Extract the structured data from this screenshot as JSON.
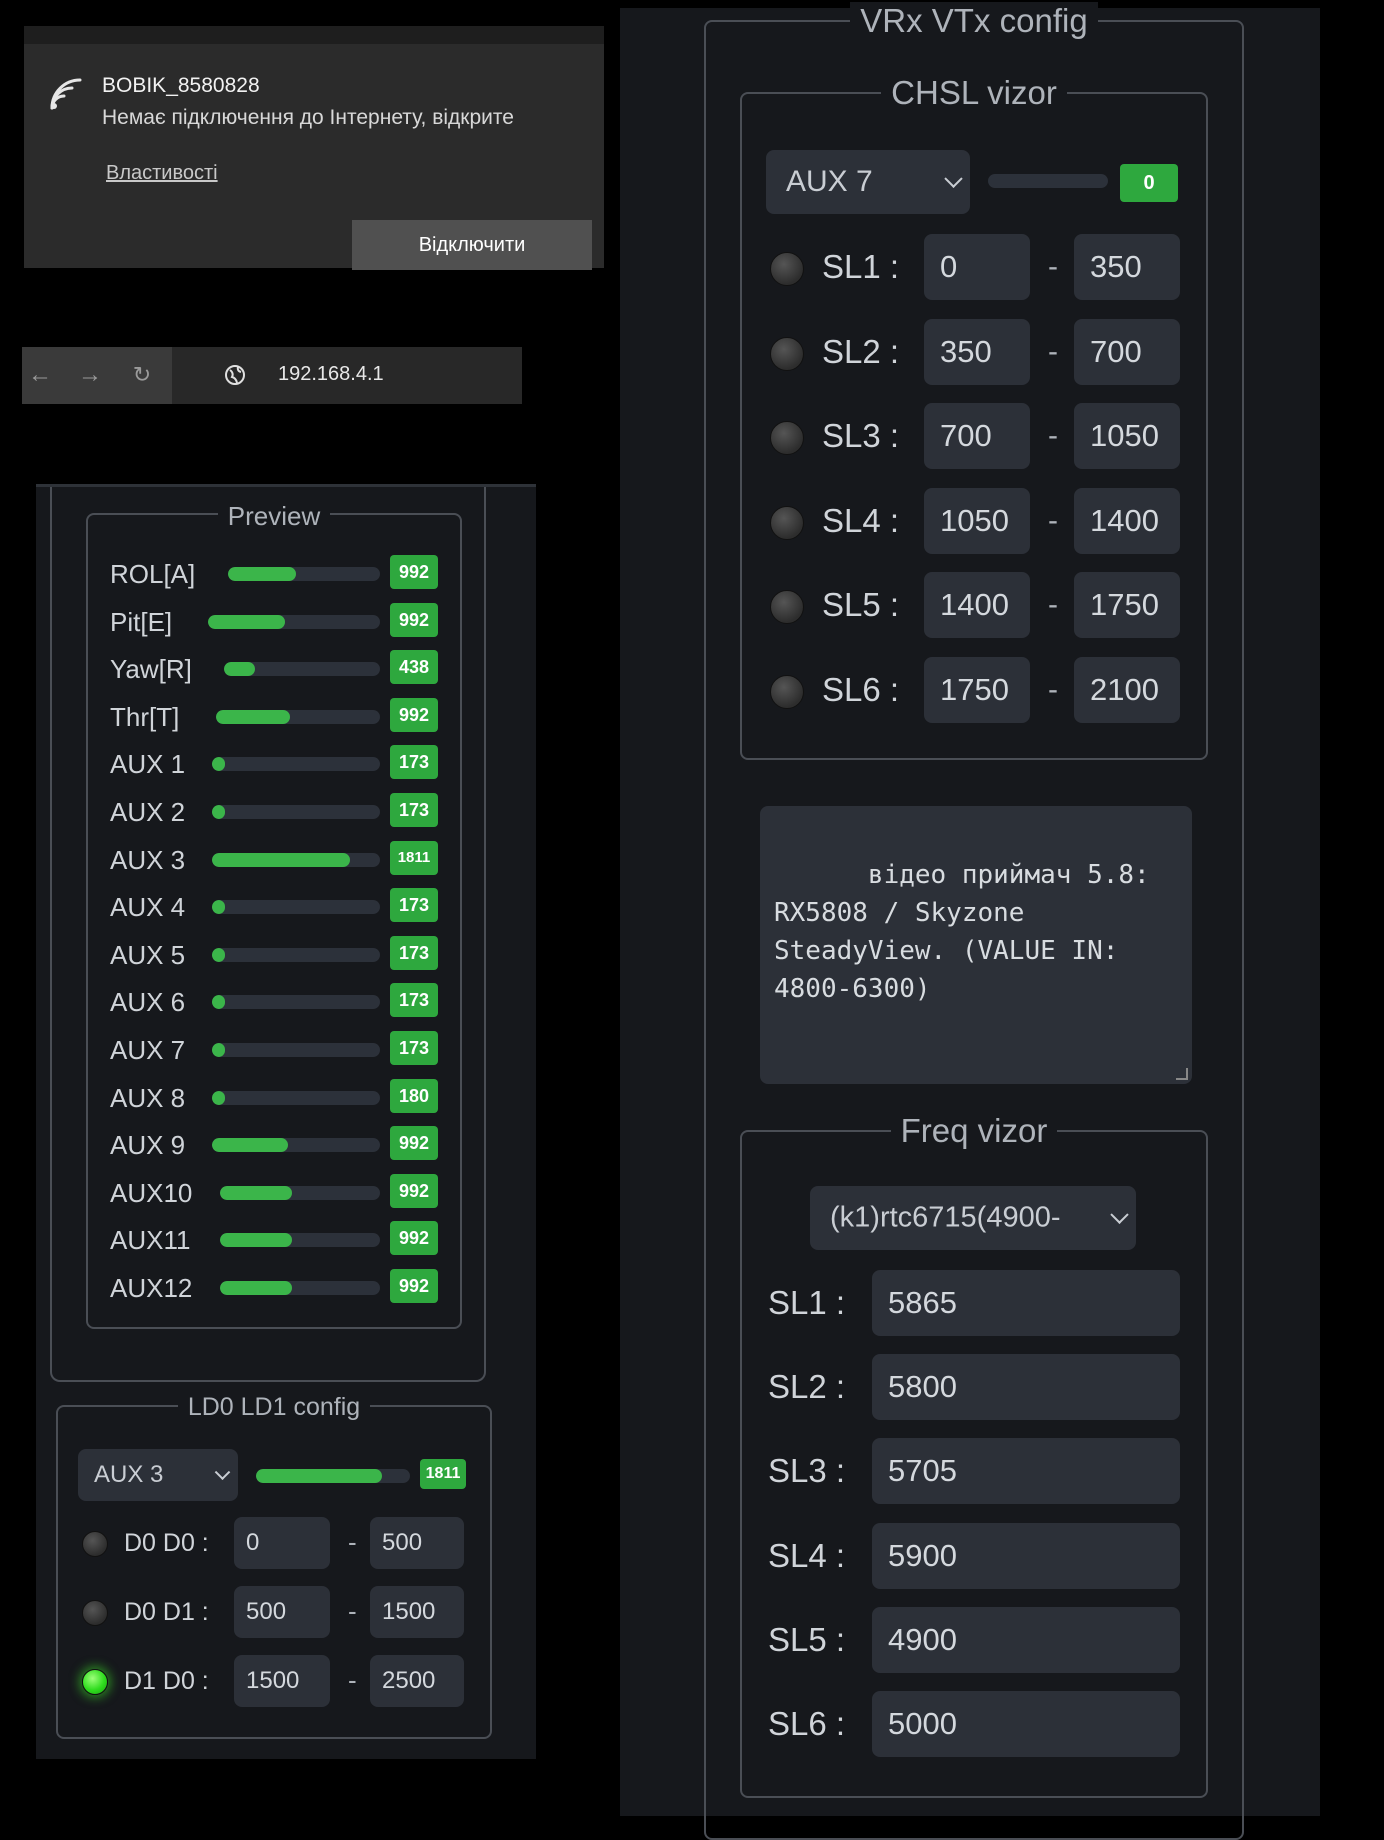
{
  "wifi": {
    "ssid": "BOBIK_8580828",
    "status": "Немає підключення до Інтернету, відкрите",
    "properties_link": "Властивості",
    "disconnect_button": "Відключити"
  },
  "browser": {
    "url": "192.168.4.1"
  },
  "preview": {
    "title": "Preview",
    "channels": [
      {
        "label": "ROL[A]",
        "value": "992",
        "level": 0.45
      },
      {
        "label": "Pit[E]",
        "value": "992",
        "level": 0.45
      },
      {
        "label": "Yaw[R]",
        "value": "438",
        "level": 0.2
      },
      {
        "label": "Thr[T]",
        "value": "992",
        "level": 0.45
      },
      {
        "label": "AUX 1",
        "value": "173",
        "level": 0.08
      },
      {
        "label": "AUX 2",
        "value": "173",
        "level": 0.08
      },
      {
        "label": "AUX 3",
        "value": "1811",
        "level": 0.82
      },
      {
        "label": "AUX 4",
        "value": "173",
        "level": 0.08
      },
      {
        "label": "AUX 5",
        "value": "173",
        "level": 0.08
      },
      {
        "label": "AUX 6",
        "value": "173",
        "level": 0.08
      },
      {
        "label": "AUX 7",
        "value": "173",
        "level": 0.08
      },
      {
        "label": "AUX 8",
        "value": "180",
        "level": 0.08
      },
      {
        "label": "AUX 9",
        "value": "992",
        "level": 0.45
      },
      {
        "label": "AUX10",
        "value": "992",
        "level": 0.45
      },
      {
        "label": "AUX11",
        "value": "992",
        "level": 0.45
      },
      {
        "label": "AUX12",
        "value": "992",
        "level": 0.45
      }
    ]
  },
  "ld_config": {
    "title": "LD0 LD1 config",
    "select": "AUX 3",
    "value": "1811",
    "level": 0.82,
    "rows": [
      {
        "label": "D0 D0 :",
        "from": "0",
        "to": "500",
        "active": false
      },
      {
        "label": "D0 D1 :",
        "from": "500",
        "to": "1500",
        "active": false
      },
      {
        "label": "D1 D0 :",
        "from": "1500",
        "to": "2500",
        "active": true
      }
    ]
  },
  "vrx_vtx": {
    "title": "VRx VTx config",
    "chsl": {
      "title": "CHSL vizor",
      "select": "AUX 7",
      "value": "0",
      "level": 0.0,
      "rows": [
        {
          "label": "SL1 :",
          "from": "0",
          "to": "350"
        },
        {
          "label": "SL2 :",
          "from": "350",
          "to": "700"
        },
        {
          "label": "SL3 :",
          "from": "700",
          "to": "1050"
        },
        {
          "label": "SL4 :",
          "from": "1050",
          "to": "1400"
        },
        {
          "label": "SL5 :",
          "from": "1400",
          "to": "1750"
        },
        {
          "label": "SL6 :",
          "from": "1750",
          "to": "2100"
        }
      ]
    },
    "description": "відео приймач 5.8:\nRX5808 / Skyzone\nSteadyView. (VALUE IN:\n4800-6300)",
    "freq": {
      "title": "Freq vizor",
      "select": "(k1)rtc6715(4900-",
      "rows": [
        {
          "label": "SL1 :",
          "value": "5865"
        },
        {
          "label": "SL2 :",
          "value": "5800"
        },
        {
          "label": "SL3 :",
          "value": "5705"
        },
        {
          "label": "SL4 :",
          "value": "5900"
        },
        {
          "label": "SL5 :",
          "value": "4900"
        },
        {
          "label": "SL6 :",
          "value": "5000"
        }
      ]
    }
  },
  "colors": {
    "accent_green": "#2ea83e",
    "panel_bg": "#16181c",
    "input_bg": "#2c3038"
  }
}
